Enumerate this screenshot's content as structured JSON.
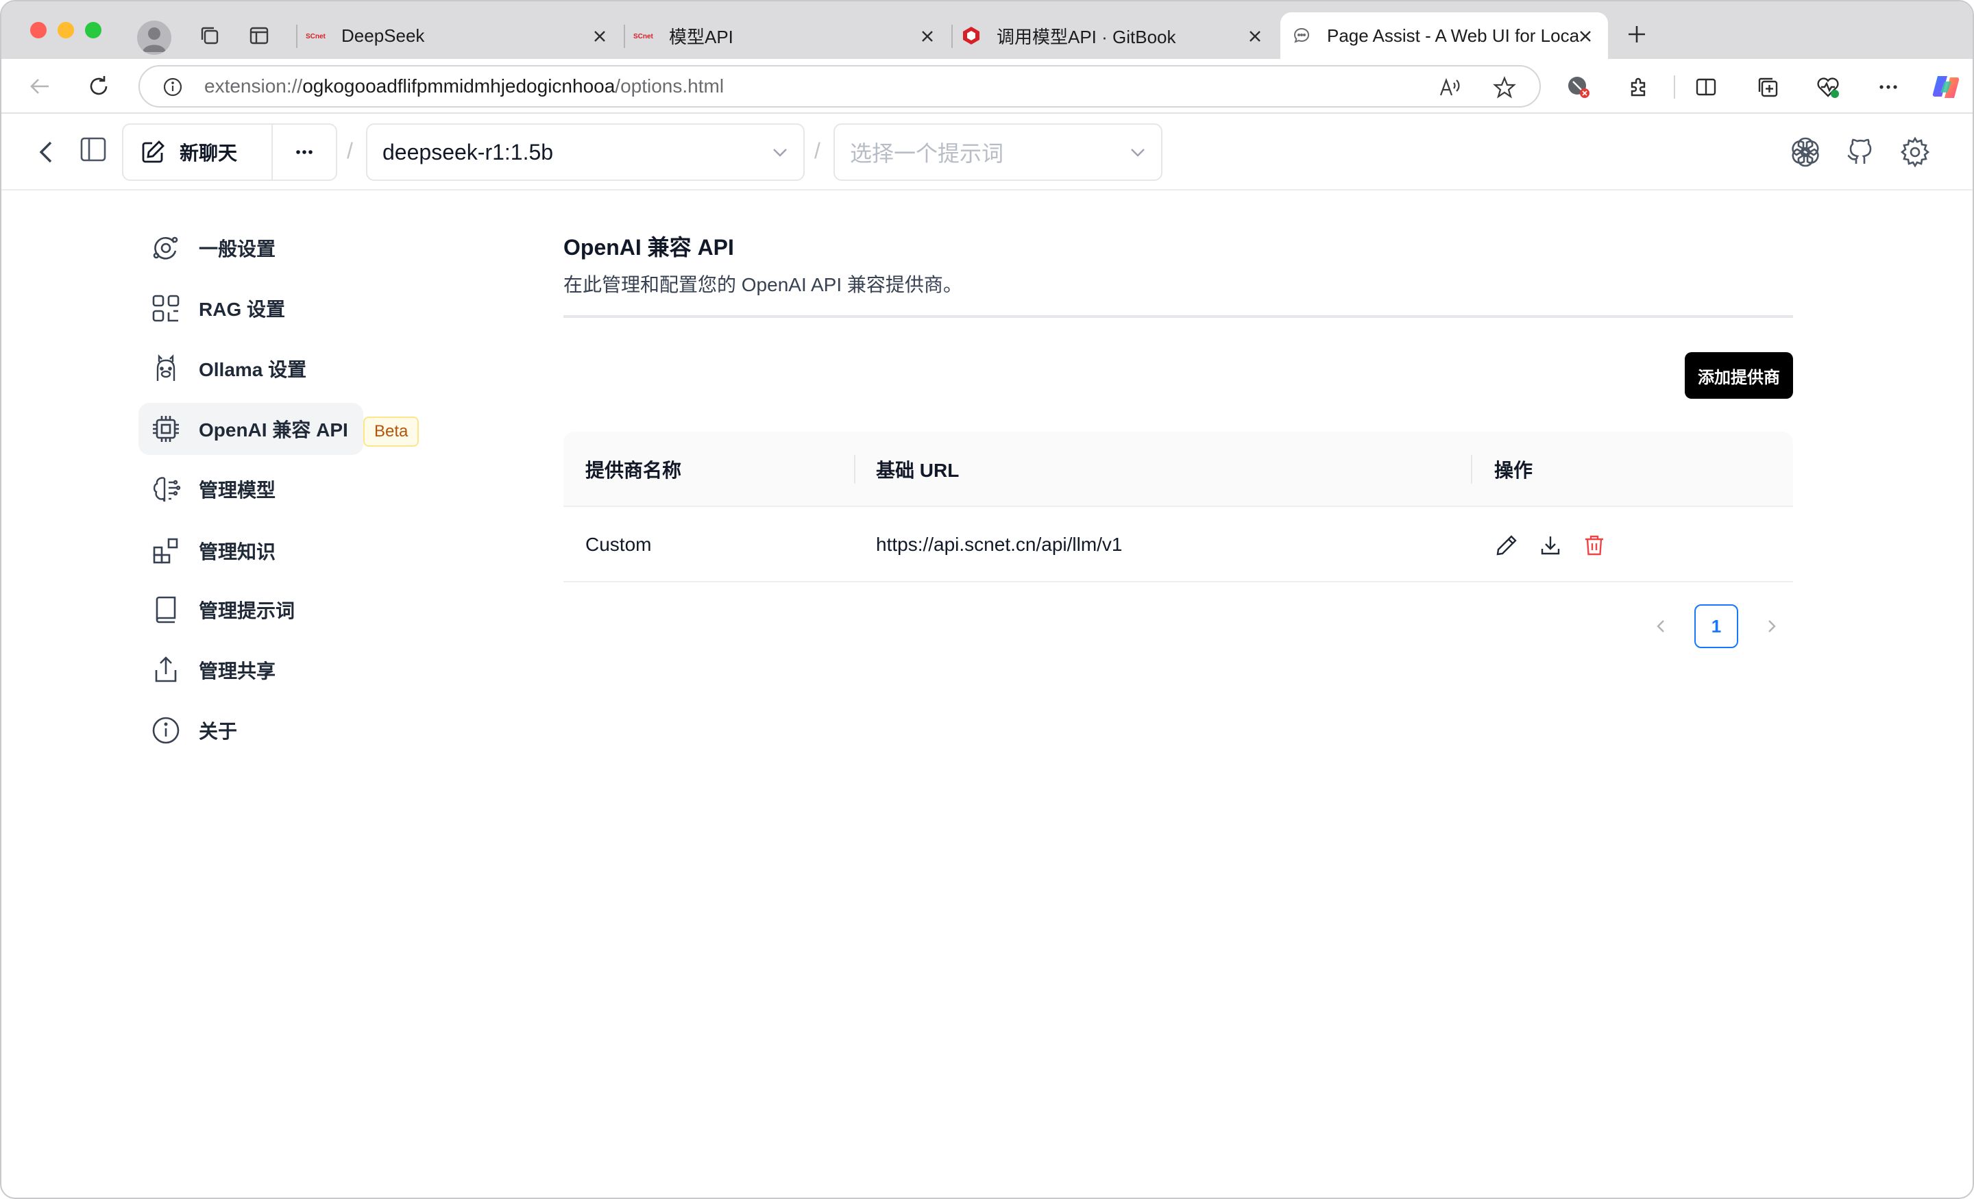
{
  "browser": {
    "tabs": [
      {
        "title": "DeepSeek",
        "favicon": "scnet-icon"
      },
      {
        "title": "模型API",
        "favicon": "scnet-icon"
      },
      {
        "title": "调用模型API · GitBook",
        "favicon": "gitbook-icon"
      },
      {
        "title": "Page Assist - A Web UI for Loca",
        "favicon": "chat-bubble-icon",
        "active": true
      }
    ],
    "address": {
      "scheme": "extension://",
      "host": "ogkogooadflifpmmidmhjedogicnhooa",
      "path": "/options.html"
    }
  },
  "header": {
    "new_chat_label": "新聊天",
    "model_select": "deepseek-r1:1.5b",
    "prompt_placeholder": "选择一个提示词",
    "separator": "/"
  },
  "sidebar": {
    "items": [
      {
        "label": "一般设置",
        "icon": "settings-orbit-icon"
      },
      {
        "label": "RAG 设置",
        "icon": "scan-icon"
      },
      {
        "label": "Ollama 设置",
        "icon": "llama-icon"
      },
      {
        "label": "OpenAI 兼容 API",
        "icon": "cpu-chip-icon",
        "active": true
      },
      {
        "label": "管理模型",
        "icon": "brain-icon"
      },
      {
        "label": "管理知识",
        "icon": "blocks-icon"
      },
      {
        "label": "管理提示词",
        "icon": "book-icon"
      },
      {
        "label": "管理共享",
        "icon": "share-icon"
      },
      {
        "label": "关于",
        "icon": "info-icon"
      }
    ],
    "beta_badge": "Beta"
  },
  "main": {
    "title": "OpenAI 兼容 API",
    "subtitle": "在此管理和配置您的 OpenAI API 兼容提供商。",
    "add_button": "添加提供商",
    "table": {
      "columns": [
        "提供商名称",
        "基础 URL",
        "操作"
      ],
      "rows": [
        {
          "name": "Custom",
          "url": "https://api.scnet.cn/api/llm/v1"
        }
      ]
    },
    "pagination": {
      "current": "1"
    }
  },
  "colors": {
    "accent": "#1677ff",
    "danger": "#ef4444",
    "primary_button": "#000000",
    "beta_text": "#b45309"
  }
}
